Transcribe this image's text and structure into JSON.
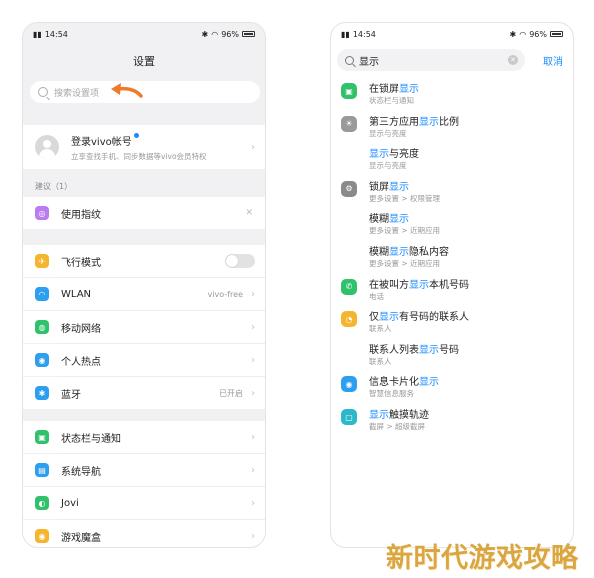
{
  "left_phone": {
    "status": {
      "time": "14:54",
      "battery": "96%"
    },
    "title": "设置",
    "search_placeholder": "搜索设置项",
    "account": {
      "title": "登录vivo帐号",
      "subtitle": "立享查找手机、同步数据等vivo会员特权"
    },
    "suggestion_label": "建议（1）",
    "suggestion_item": "使用指纹",
    "group1": [
      {
        "label": "飞行模式",
        "value": "",
        "icon": "airplane-icon",
        "color": "#f5b52e"
      },
      {
        "label": "WLAN",
        "value": "vivo-free",
        "icon": "wifi-icon",
        "color": "#2d9ff0"
      },
      {
        "label": "移动网络",
        "value": "",
        "icon": "globe-icon",
        "color": "#2fc26b"
      },
      {
        "label": "个人热点",
        "value": "",
        "icon": "hotspot-icon",
        "color": "#2d9ff0"
      },
      {
        "label": "蓝牙",
        "value": "已开启",
        "icon": "bluetooth-icon",
        "color": "#2d9ff0"
      }
    ],
    "group2": [
      {
        "label": "状态栏与通知",
        "icon": "statusbar-icon",
        "color": "#2fc26b"
      },
      {
        "label": "系统导航",
        "icon": "navigation-icon",
        "color": "#2d9ff0"
      },
      {
        "label": "Jovi",
        "icon": "jovi-icon",
        "color": "#2fc26b"
      },
      {
        "label": "游戏魔盒",
        "icon": "game-icon",
        "color": "#f5b52e"
      }
    ]
  },
  "right_phone": {
    "status": {
      "time": "14:54",
      "battery": "96%"
    },
    "query": "显示",
    "cancel": "取消",
    "results": [
      {
        "pre": "在锁屏",
        "hl": "显示",
        "post": "",
        "sub": "状态栏与通知",
        "icon": "lockscreen-icon",
        "color": "#2fc26b"
      },
      {
        "pre": "第三方应用",
        "hl": "显示",
        "post": "比例",
        "sub": "显示与亮度",
        "icon": "brightness-icon",
        "color": "#9a9a9a"
      },
      {
        "pre": "",
        "hl": "显示",
        "post": "与亮度",
        "sub": "显示与亮度",
        "icon": "",
        "color": ""
      },
      {
        "pre": "锁屏",
        "hl": "显示",
        "post": "",
        "sub": "更多设置 > 权限管理",
        "icon": "more-settings-icon",
        "color": "#8a8a8a"
      },
      {
        "pre": "模糊",
        "hl": "显示",
        "post": "",
        "sub": "更多设置 > 近期应用",
        "icon": "",
        "color": ""
      },
      {
        "pre": "模糊",
        "hl": "显示",
        "post": "隐私内容",
        "sub": "更多设置 > 近期应用",
        "icon": "",
        "color": ""
      },
      {
        "pre": "在被叫方",
        "hl": "显示",
        "post": "本机号码",
        "sub": "电话",
        "icon": "phone-icon",
        "color": "#2fc26b"
      },
      {
        "pre": "仅",
        "hl": "显示",
        "post": "有号码的联系人",
        "sub": "联系人",
        "icon": "contacts-icon",
        "color": "#f5b52e"
      },
      {
        "pre": "联系人列表",
        "hl": "显示",
        "post": "号码",
        "sub": "联系人",
        "icon": "",
        "color": ""
      },
      {
        "pre": "信息卡片化",
        "hl": "显示",
        "post": "",
        "sub": "智慧信息服务",
        "icon": "message-icon",
        "color": "#2d9ff0"
      },
      {
        "pre": "",
        "hl": "显示",
        "post": "触摸轨迹",
        "sub": "截屏 > 超级截屏",
        "icon": "screenshot-icon",
        "color": "#2bb9c9"
      }
    ]
  },
  "watermark": "新时代游戏攻略",
  "accent_color": "#1a8cff",
  "annotation_arrow_color": "#f07a2a"
}
